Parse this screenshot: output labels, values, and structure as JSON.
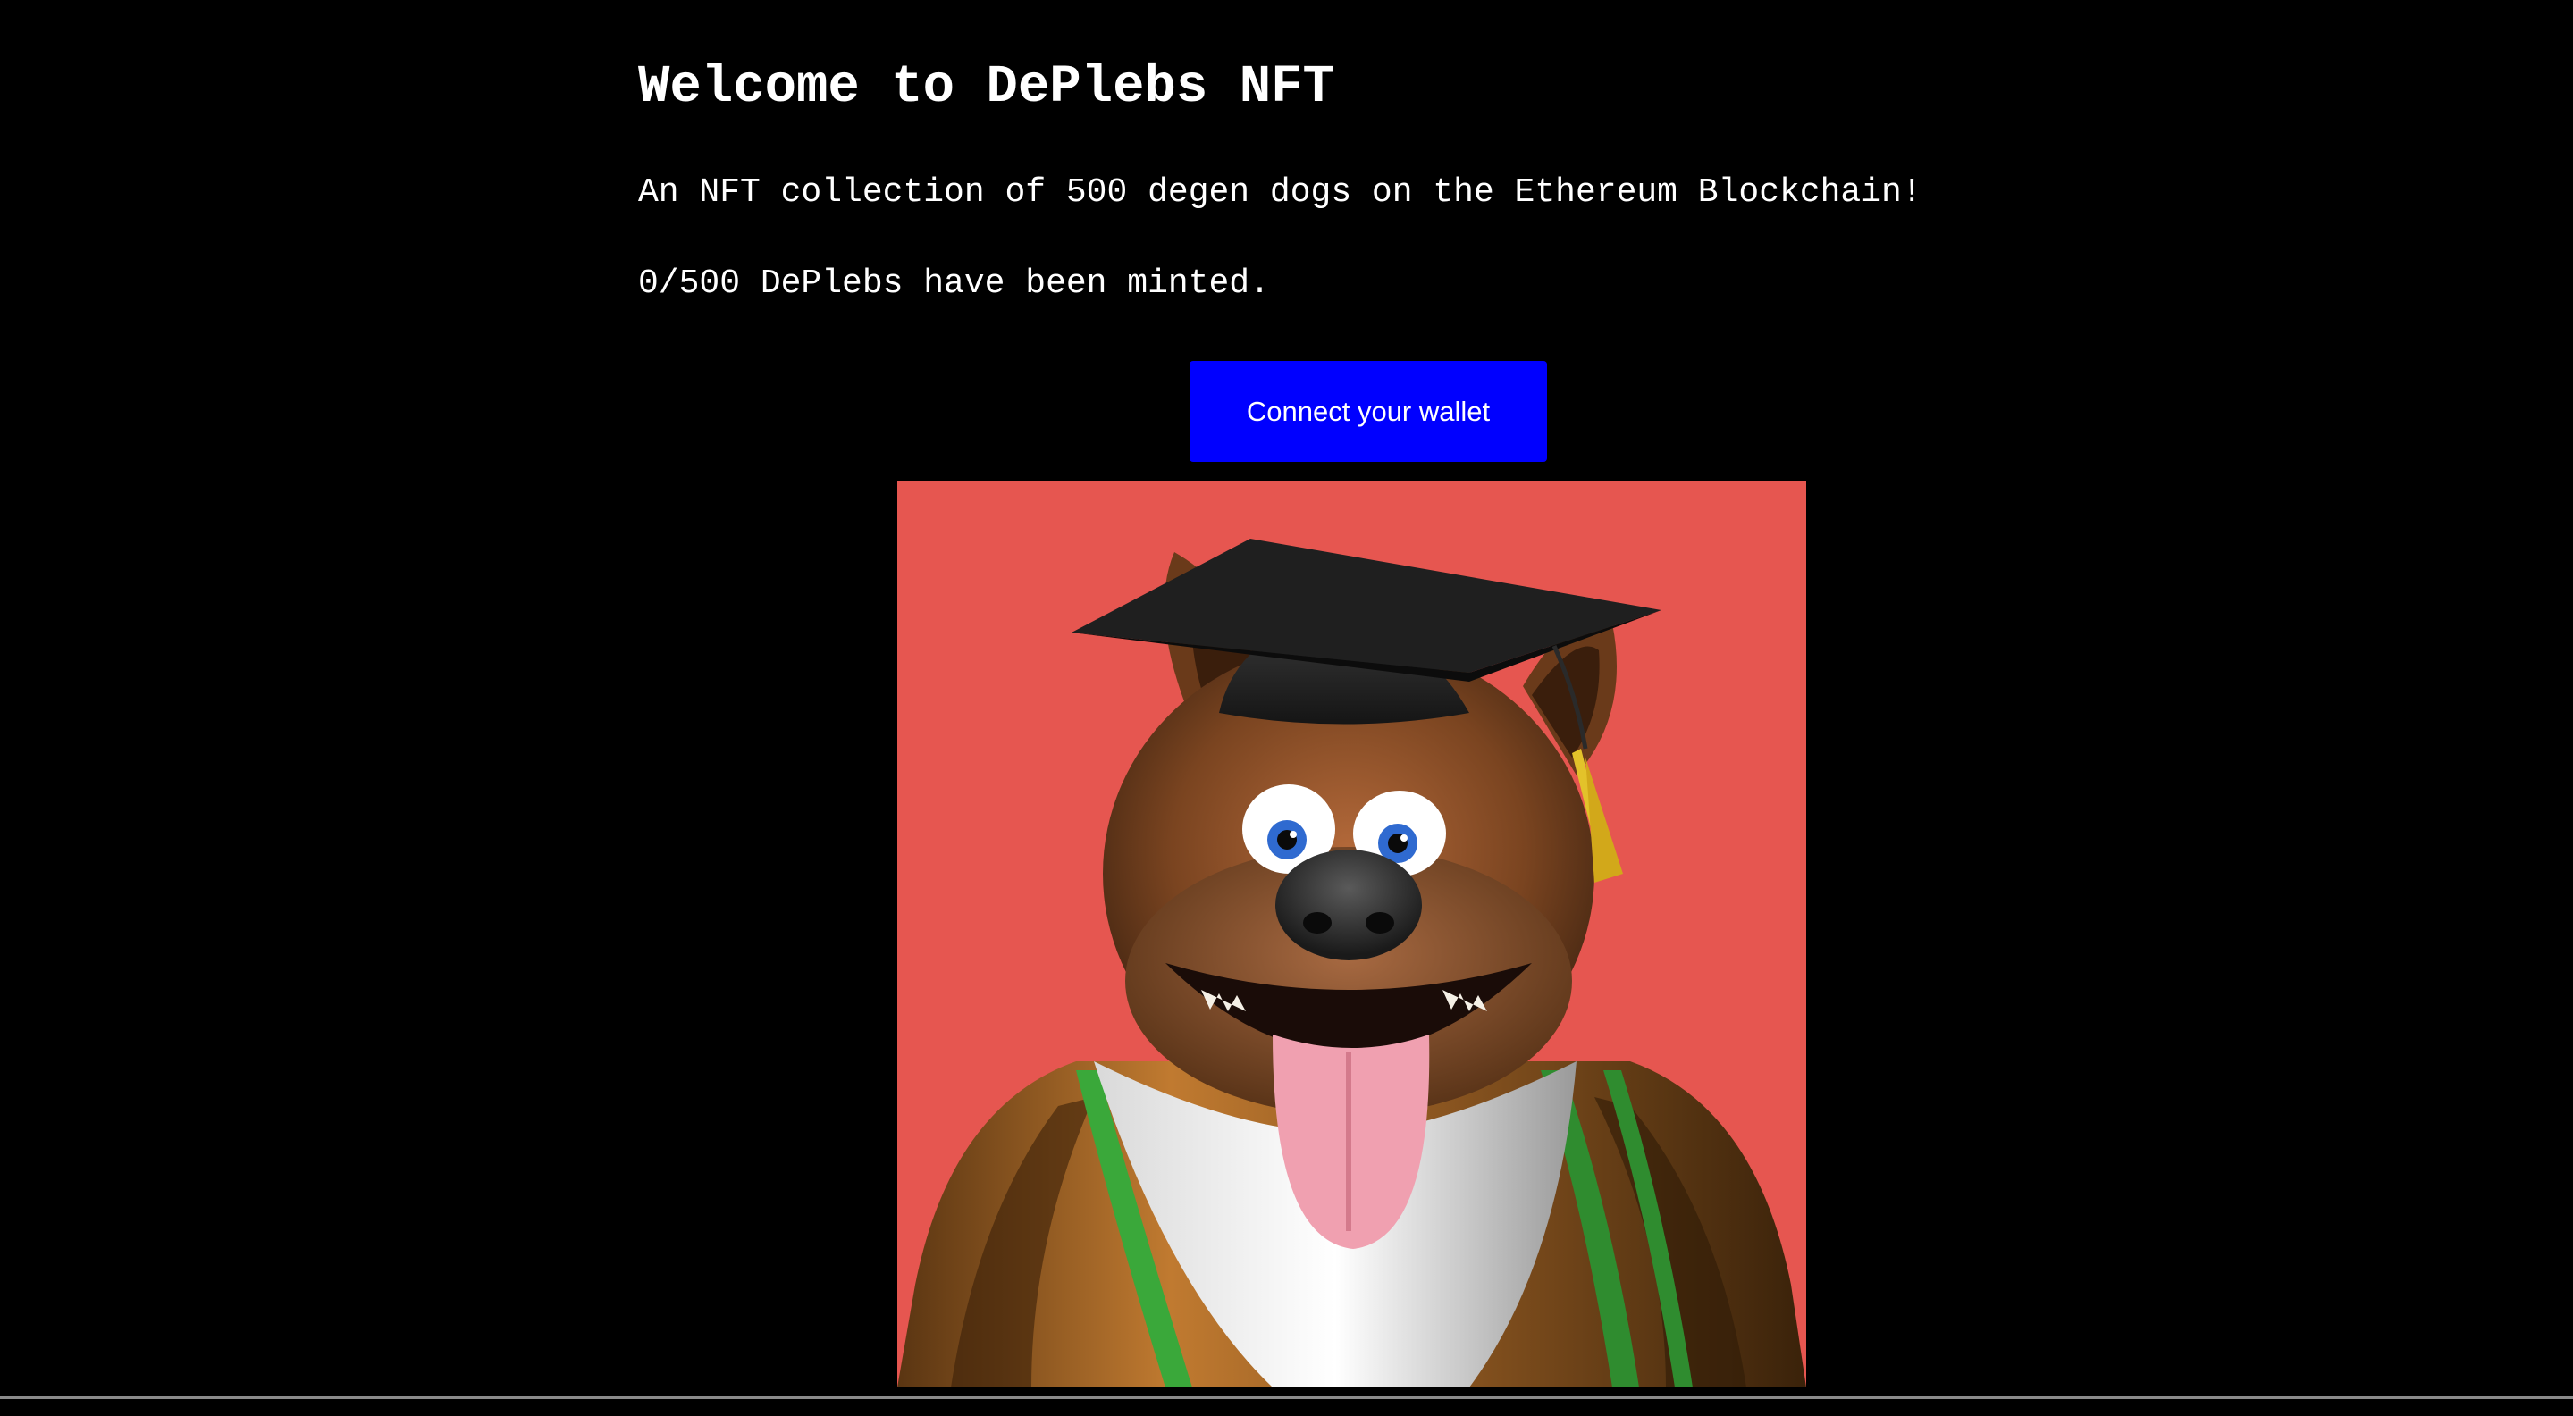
{
  "header": {
    "title": "Welcome to DePlebs NFT",
    "subtitle": "An NFT collection of 500 degen dogs on the Ethereum Blockchain!",
    "minted_status": "0/500 DePlebs have been minted."
  },
  "actions": {
    "connect_wallet_label": "Connect your wallet"
  },
  "nft_preview": {
    "description": "Cartoon dog wearing a graduation cap and academic stole"
  },
  "colors": {
    "background": "#000000",
    "text": "#ffffff",
    "button": "#0000ff",
    "nft_background": "#e65650"
  }
}
